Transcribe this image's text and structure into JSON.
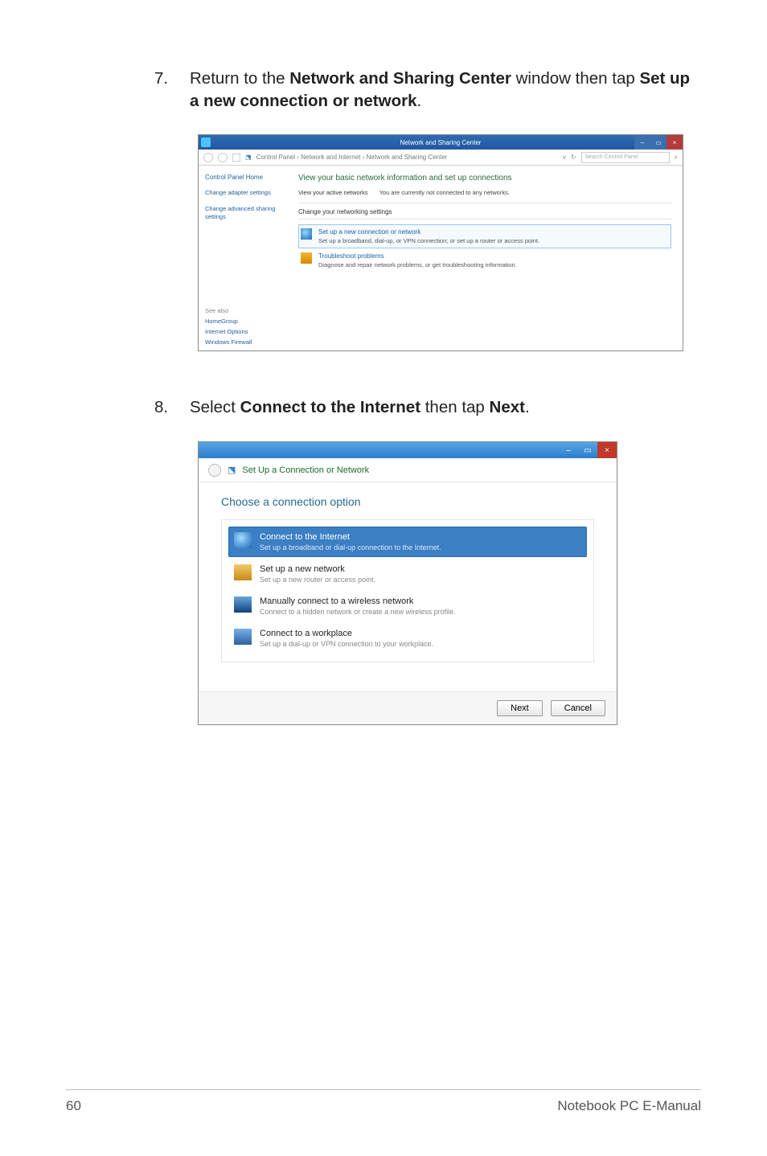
{
  "steps": {
    "s7_num": "7.",
    "s7_a": "Return to the ",
    "s7_b": "Network and Sharing Center",
    "s7_c": " window then tap ",
    "s7_d": "Set up a new connection or network",
    "s7_e": ".",
    "s8_num": "8.",
    "s8_a": "Select ",
    "s8_b": "Connect to the Internet",
    "s8_c": " then tap ",
    "s8_d": "Next",
    "s8_e": "."
  },
  "shot1": {
    "title": "Network and Sharing Center",
    "breadcrumb": "Control Panel  ›  Network and Internet  ›  Network and Sharing Center",
    "search_placeholder": "Search Control Panel",
    "glyph_search": "⌕",
    "left": {
      "home": "Control Panel Home",
      "l1": "Change adapter settings",
      "l2": "Change advanced sharing settings",
      "seealso": "See also",
      "s1": "HomeGroup",
      "s2": "Internet Options",
      "s3": "Windows Firewall"
    },
    "right": {
      "heading": "View your basic network information and set up connections",
      "active_label": "View your active networks",
      "active_msg": "You are currently not connected to any networks.",
      "change_label": "Change your networking settings",
      "opt1_title": "Set up a new connection or network",
      "opt1_sub": "Set up a broadband, dial-up, or VPN connection; or set up a router or access point.",
      "opt2_title": "Troubleshoot problems",
      "opt2_sub": "Diagnose and repair network problems, or get troubleshooting information."
    },
    "win": {
      "min": "–",
      "max": "▭",
      "close": "×"
    }
  },
  "shot2": {
    "title": "Set Up a Connection or Network",
    "heading": "Choose a connection option",
    "options": {
      "o1_t": "Connect to the Internet",
      "o1_s": "Set up a broadband or dial-up connection to the Internet.",
      "o2_t": "Set up a new network",
      "o2_s": "Set up a new router or access point.",
      "o3_t": "Manually connect to a wireless network",
      "o3_s": "Connect to a hidden network or create a new wireless profile.",
      "o4_t": "Connect to a workplace",
      "o4_s": "Set up a dial-up or VPN connection to your workplace."
    },
    "buttons": {
      "next": "Next",
      "cancel": "Cancel"
    },
    "win": {
      "min": "–",
      "max": "▭",
      "close": "×"
    },
    "back_glyph": "‹"
  },
  "footer": {
    "page": "60",
    "label": "Notebook PC E-Manual"
  }
}
